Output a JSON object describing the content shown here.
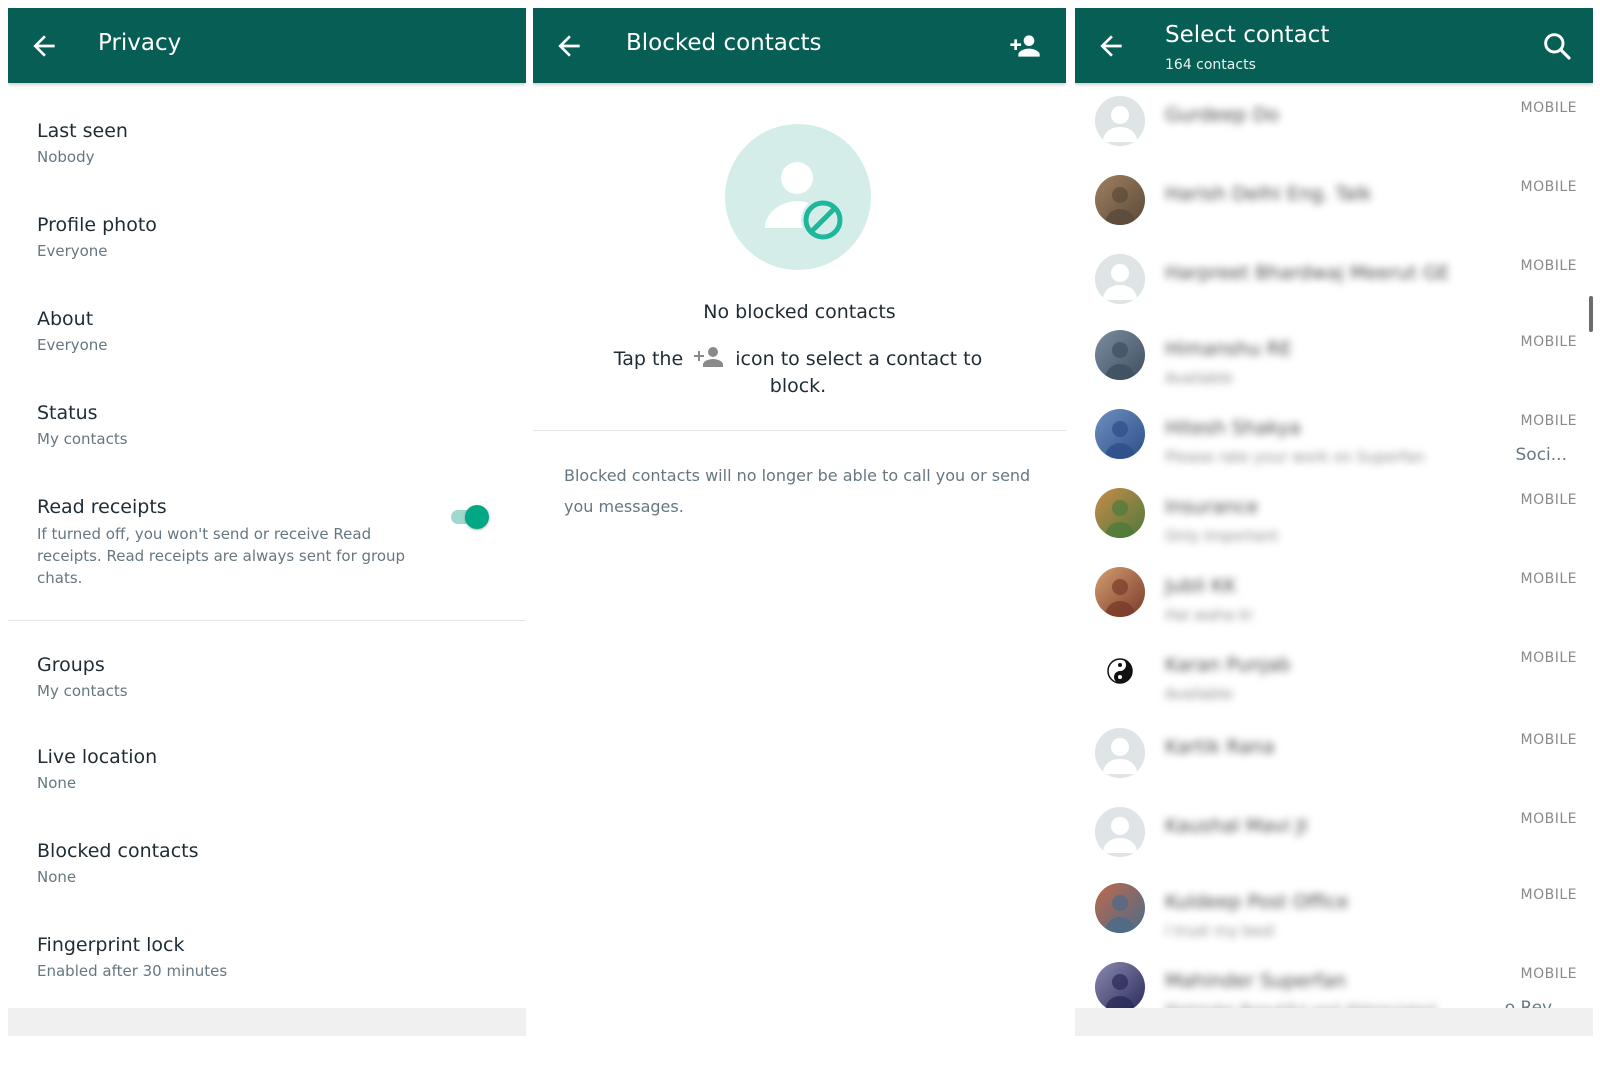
{
  "colors": {
    "header": "#075e54",
    "accent": "#00a884",
    "illustration_bg": "#d4ede8"
  },
  "privacy": {
    "title": "Privacy",
    "settings": [
      {
        "label": "Last seen",
        "value": "Nobody"
      },
      {
        "label": "Profile photo",
        "value": "Everyone"
      },
      {
        "label": "About",
        "value": "Everyone"
      },
      {
        "label": "Status",
        "value": "My contacts"
      }
    ],
    "read_receipts": {
      "label": "Read receipts",
      "desc": "If turned off, you won't send or receive Read receipts. Read receipts are always sent for group chats.",
      "enabled": true
    },
    "settings2": [
      {
        "label": "Groups",
        "value": "My contacts"
      },
      {
        "label": "Live location",
        "value": "None"
      },
      {
        "label": "Blocked contacts",
        "value": "None"
      },
      {
        "label": "Fingerprint lock",
        "value": "Enabled after 30 minutes"
      }
    ]
  },
  "blocked": {
    "title": "Blocked contacts",
    "empty_title": "No blocked contacts",
    "hint_before": "Tap the",
    "hint_after": "icon to select a contact to block.",
    "info": "Blocked contacts will no longer be able to call you or send you messages."
  },
  "select": {
    "title": "Select contact",
    "subtitle": "164 contacts",
    "contacts": [
      {
        "name": "Gurdeep Do",
        "status": "",
        "type": "MOBILE",
        "avatar": "default-avatar-icon"
      },
      {
        "name": "Harish Delhi Eng. Talk",
        "status": "",
        "type": "MOBILE",
        "avatar": "photo-avatar"
      },
      {
        "name": "Harpreet Bhardwaj Meerut GE",
        "status": "",
        "type": "MOBILE",
        "avatar": "default-avatar-icon"
      },
      {
        "name": "Himanshu RE",
        "status": "Available",
        "type": "MOBILE",
        "avatar": "photo-avatar"
      },
      {
        "name": "Hitesh Shakya",
        "status": "Please rate your work on Superfan",
        "status_tail": "Soci...",
        "type": "MOBILE",
        "avatar": "photo-avatar"
      },
      {
        "name": "Insurance",
        "status": "Only Important",
        "type": "MOBILE",
        "avatar": "photo-avatar"
      },
      {
        "name": "Jubli KK",
        "status": "Hai waha ki",
        "type": "MOBILE",
        "avatar": "photo-avatar"
      },
      {
        "name": "Karan Punjab",
        "status": "Available",
        "type": "MOBILE",
        "avatar": "yin-yang-icon"
      },
      {
        "name": "Kartik Rana",
        "status": "",
        "type": "MOBILE",
        "avatar": "default-avatar-icon"
      },
      {
        "name": "Kaushal Mavi JI",
        "status": "",
        "type": "MOBILE",
        "avatar": "default-avatar-icon"
      },
      {
        "name": "Kuldeep Post Office",
        "status": "I trust my best",
        "type": "MOBILE",
        "avatar": "photo-avatar"
      },
      {
        "name": "Mahinder Superfan",
        "status": "Mahinder Beautiful and Abbreviated",
        "status_tail": "o Rev...",
        "type": "MOBILE",
        "avatar": "photo-avatar"
      }
    ]
  }
}
